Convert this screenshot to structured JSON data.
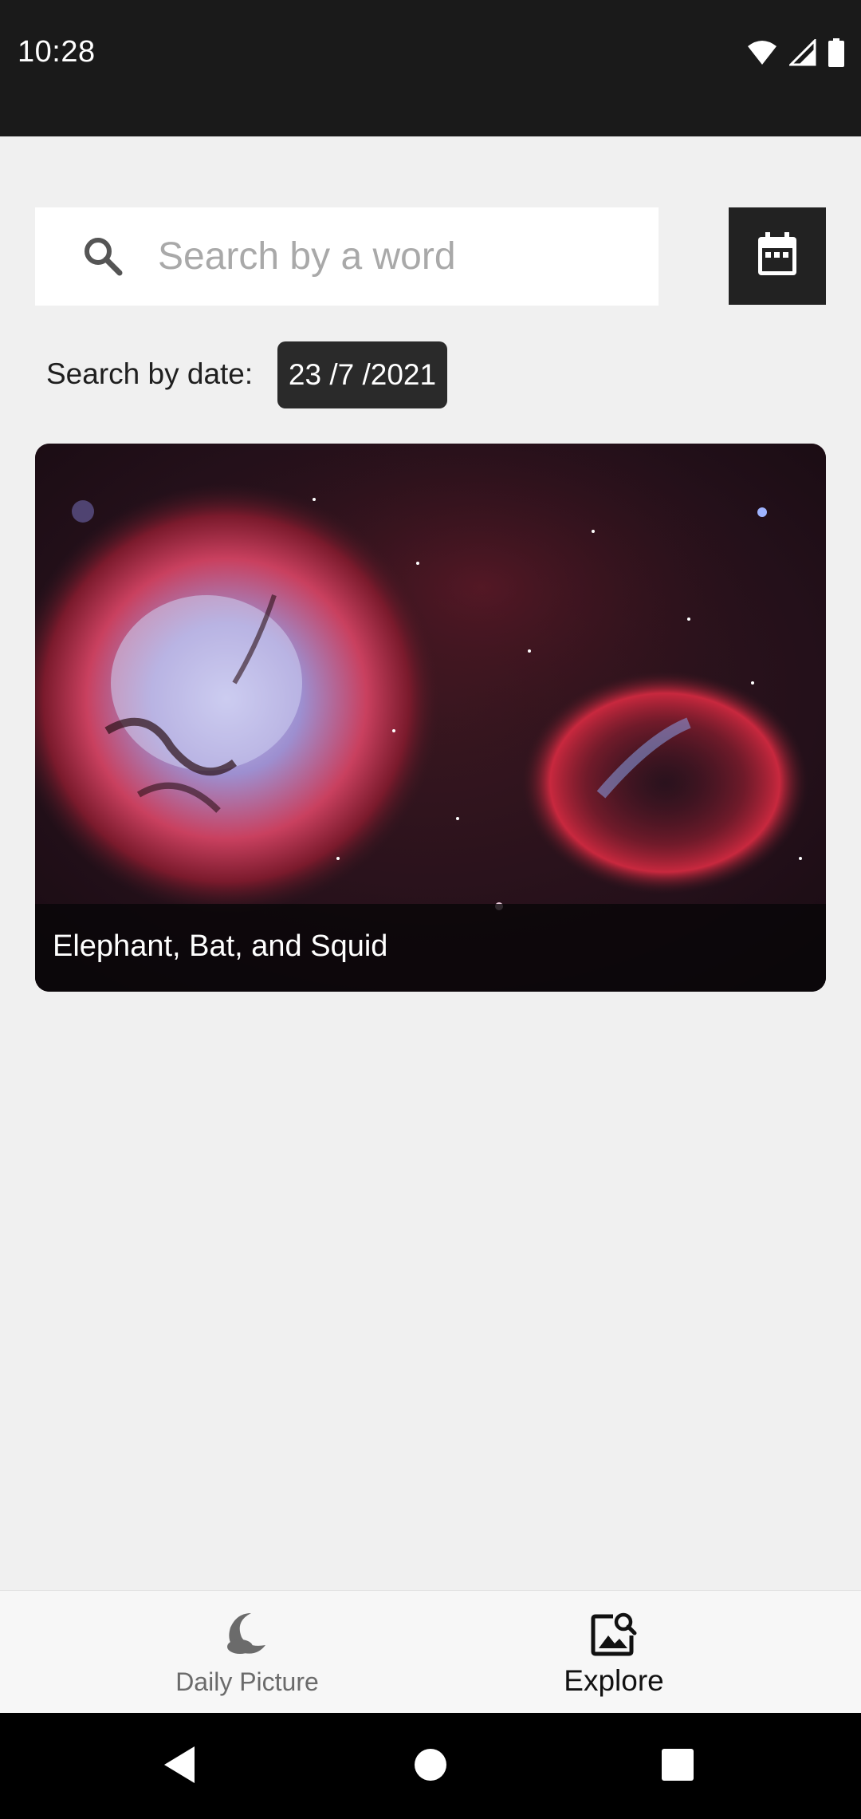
{
  "status_bar": {
    "time": "10:28",
    "icons": [
      "wifi-icon",
      "cellular-signal-icon",
      "battery-icon"
    ]
  },
  "search": {
    "placeholder": "Search by a word",
    "value": "",
    "icon": "search-icon"
  },
  "calendar_button": {
    "icon": "calendar-icon"
  },
  "date_filter": {
    "label": "Search by date:",
    "value": "23 /7 /2021"
  },
  "results": [
    {
      "title": "Elephant, Bat, and Squid",
      "image": "nebula-photo"
    }
  ],
  "bottom_nav": {
    "items": [
      {
        "label": "Daily Picture",
        "icon": "moon-cloud-icon",
        "active": false
      },
      {
        "label": "Explore",
        "icon": "image-search-icon",
        "active": true
      }
    ]
  },
  "system_nav": {
    "buttons": [
      "back-icon",
      "home-icon",
      "recents-icon"
    ]
  },
  "colors": {
    "status_bar": "#1a1a1a",
    "background": "#f0f0f0",
    "dark_button": "#222222",
    "date_chip": "#2a2a2a",
    "nav_bar": "#f7f7f7",
    "active_label": "#111111",
    "inactive_label": "#6b6b6b"
  }
}
